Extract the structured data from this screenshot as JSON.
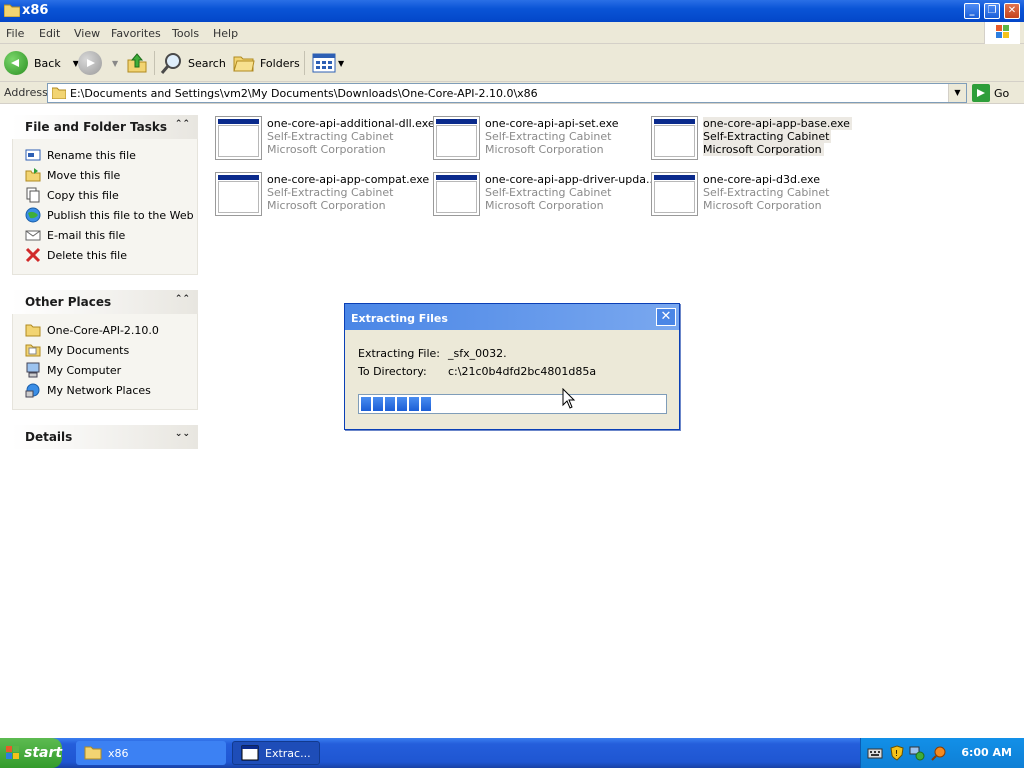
{
  "window": {
    "title": "x86",
    "min_label": "_",
    "restore_label": "❐",
    "close_label": "✕"
  },
  "menu": {
    "file": "File",
    "edit": "Edit",
    "view": "View",
    "favorites": "Favorites",
    "tools": "Tools",
    "help": "Help"
  },
  "toolbar": {
    "back": "Back",
    "search": "Search",
    "folders": "Folders"
  },
  "address": {
    "label": "Address",
    "path": "E:\\Documents and Settings\\vm2\\My Documents\\Downloads\\One-Core-API-2.10.0\\x86",
    "go": "Go"
  },
  "left_pane": {
    "file_tasks": {
      "title": "File and Folder Tasks",
      "items": [
        {
          "label": "Rename this file",
          "icon": "rename-icon"
        },
        {
          "label": "Move this file",
          "icon": "move-icon"
        },
        {
          "label": "Copy this file",
          "icon": "copy-icon"
        },
        {
          "label": "Publish this file to the Web",
          "icon": "web-publish-icon"
        },
        {
          "label": "E-mail this file",
          "icon": "email-icon"
        },
        {
          "label": "Delete this file",
          "icon": "delete-icon"
        }
      ]
    },
    "other_places": {
      "title": "Other Places",
      "items": [
        {
          "label": "One-Core-API-2.10.0",
          "icon": "folder-icon"
        },
        {
          "label": "My Documents",
          "icon": "my-documents-icon"
        },
        {
          "label": "My Computer",
          "icon": "my-computer-icon"
        },
        {
          "label": "My Network Places",
          "icon": "network-places-icon"
        }
      ]
    },
    "details": {
      "title": "Details"
    }
  },
  "files": [
    {
      "name": "one-core-api-additional-dll.exe",
      "type": "Self-Extracting Cabinet",
      "company": "Microsoft Corporation",
      "selected": false
    },
    {
      "name": "one-core-api-api-set.exe",
      "type": "Self-Extracting Cabinet",
      "company": "Microsoft Corporation",
      "selected": false
    },
    {
      "name": "one-core-api-app-base.exe",
      "type": "Self-Extracting Cabinet",
      "company": "Microsoft Corporation",
      "selected": true
    },
    {
      "name": "one-core-api-app-compat.exe",
      "type": "Self-Extracting Cabinet",
      "company": "Microsoft Corporation",
      "selected": false
    },
    {
      "name": "one-core-api-app-driver-upda...",
      "type": "Self-Extracting Cabinet",
      "company": "Microsoft Corporation",
      "selected": false
    },
    {
      "name": "one-core-api-d3d.exe",
      "type": "Self-Extracting Cabinet",
      "company": "Microsoft Corporation",
      "selected": false
    }
  ],
  "dialog": {
    "title": "Extracting Files",
    "file_label": "Extracting File:",
    "file_value": "_sfx_0032.",
    "dir_label": "To Directory:",
    "dir_value": "c:\\21c0b4dfd2bc4801d85a",
    "progress_fraction": 0.23,
    "close_label": "✕"
  },
  "taskbar": {
    "start": "start",
    "items": [
      {
        "label": "x86",
        "active": false
      },
      {
        "label": "Extrac...",
        "active": true
      }
    ],
    "clock": "6:00 AM"
  }
}
